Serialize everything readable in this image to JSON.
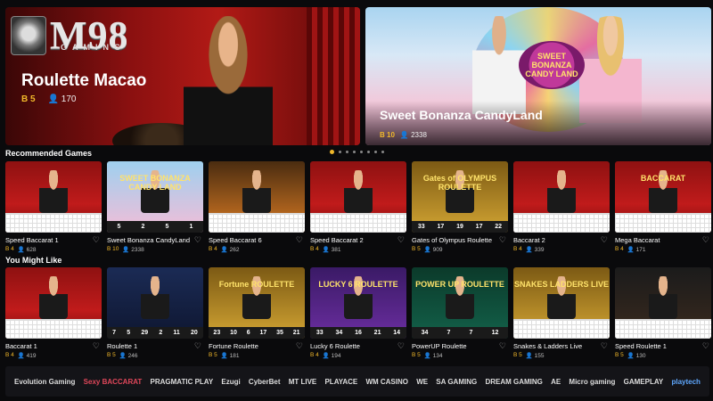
{
  "brand": {
    "logo": "M98",
    "logo_sub": "GAMING"
  },
  "hero": [
    {
      "title": "Roulette Macao",
      "bet": "B 5",
      "players": "170"
    },
    {
      "title": "Sweet Bonanza CandyLand",
      "art_title_line1": "SWEET",
      "art_title_line2": "BONANZA",
      "art_title_line3": "CANDY LAND",
      "bet": "B 10",
      "players": "2338"
    }
  ],
  "carousel": {
    "count": 8,
    "active": 0
  },
  "recommended": {
    "title": "Recommended Games",
    "games": [
      {
        "name": "Speed Baccarat 1",
        "bet": "B 4",
        "players": "628"
      },
      {
        "name": "Sweet Bonanza CandyLand",
        "bet": "B 10",
        "players": "2338",
        "art": "SWEET BONANZA CANDY LAND",
        "nums": [
          "5",
          "2",
          "5",
          "1"
        ]
      },
      {
        "name": "Speed Baccarat 6",
        "bet": "B 4",
        "players": "262"
      },
      {
        "name": "Speed Baccarat 2",
        "bet": "B 4",
        "players": "381"
      },
      {
        "name": "Gates of Olympus Roulette",
        "bet": "B 5",
        "players": "909",
        "art": "Gates of OLYMPUS ROULETTE",
        "nums": [
          "33",
          "17",
          "19",
          "17",
          "22"
        ]
      },
      {
        "name": "Baccarat 2",
        "bet": "B 4",
        "players": "339"
      },
      {
        "name": "Mega Baccarat",
        "bet": "B 4",
        "players": "171",
        "art": "BACCARAT"
      }
    ]
  },
  "you_might_like": {
    "title": "You Might Like",
    "games": [
      {
        "name": "Baccarat 1",
        "bet": "B 4",
        "players": "419"
      },
      {
        "name": "Roulette 1",
        "bet": "B 5",
        "players": "246",
        "nums": [
          "7",
          "5",
          "29",
          "2",
          "11",
          "20"
        ]
      },
      {
        "name": "Fortune Roulette",
        "bet": "B 5",
        "players": "181",
        "art": "Fortune ROULETTE",
        "nums": [
          "23",
          "10",
          "6",
          "17",
          "35",
          "21"
        ]
      },
      {
        "name": "Lucky 6 Roulette",
        "bet": "B 4",
        "players": "194",
        "art": "LUCKY 6 ROULETTE",
        "nums": [
          "33",
          "34",
          "16",
          "21",
          "14"
        ]
      },
      {
        "name": "PowerUP Roulette",
        "bet": "B 5",
        "players": "134",
        "art": "POWER UP ROULETTE",
        "nums": [
          "34",
          "7",
          "7",
          "12"
        ]
      },
      {
        "name": "Snakes & Ladders Live",
        "bet": "B 5",
        "players": "155",
        "art": "SNAKES LADDERS LIVE"
      },
      {
        "name": "Speed Roulette 1",
        "bet": "B 5",
        "players": "130"
      }
    ]
  },
  "providers": [
    "Evolution Gaming",
    "Sexy BACCARAT",
    "PRAGMATIC PLAY",
    "Ezugi",
    "CyberBet",
    "MT LIVE",
    "PLAYACE",
    "WM CASINO",
    "WE",
    "SA GAMING",
    "DREAM GAMING",
    "AE",
    "Micro gaming",
    "GAMEPLAY",
    "playtech"
  ]
}
